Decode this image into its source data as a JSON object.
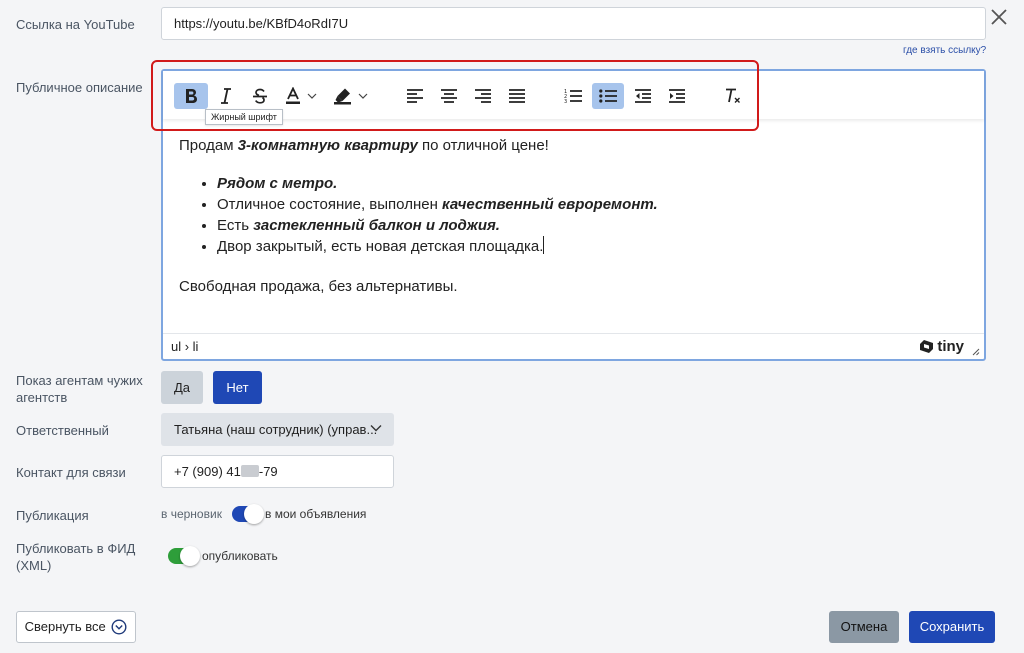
{
  "youtube": {
    "label": "Ссылка на YouTube",
    "value": "https://youtu.be/KBfD4oRdI7U",
    "help_link": "где взять ссылку?"
  },
  "description": {
    "label": "Публичное описание",
    "toolbar": {
      "tooltip": "Жирный шрифт",
      "buttons": [
        "bold",
        "italic",
        "strikethrough",
        "text-color",
        "highlight-color",
        "align-left",
        "align-center",
        "align-right",
        "align-justify",
        "numbered-list",
        "bullet-list",
        "outdent",
        "indent",
        "clear-formatting"
      ],
      "active": [
        "bold",
        "bullet-list"
      ]
    },
    "content": {
      "p1_before": "Продам ",
      "p1_bold": "3-комнатную квартиру",
      "p1_after": " по отличной цене!",
      "li1_bold": "Рядом с метро.",
      "li2_before": "Отличное состояние, выполнен ",
      "li2_bold": "качественный евроремонт.",
      "li3_before": "Есть ",
      "li3_bold": "застекленный балкон и лоджия.",
      "li4": "Двор закрытый, есть новая детская площадка.",
      "p2": "Свободная продажа, без альтернативы."
    },
    "status_path": "ul › li",
    "brand": "tiny"
  },
  "agents": {
    "label": "Показ агентам чужих агентств",
    "yes": "Да",
    "no": "Нет",
    "selected": "no"
  },
  "responsible": {
    "label": "Ответственный",
    "value": "Татьяна (наш сотрудник) (управ..."
  },
  "contact": {
    "label": "Контакт для связи",
    "value_start": "+7 (909) 41",
    "value_end": "-79"
  },
  "publication": {
    "label": "Публикация",
    "left": "в черновик",
    "right": "в мои объявления",
    "state": "в мои объявления"
  },
  "feed": {
    "label": "Публиковать в ФИД (XML)",
    "text": "опубликовать",
    "state": "on"
  },
  "footer": {
    "collapse": "Свернуть все",
    "cancel": "Отмена",
    "save": "Сохранить"
  },
  "colors": {
    "primary": "#1f48b5",
    "toggle_on": "#2e9e3a",
    "highlight_frame": "#d11a1a",
    "editor_active_button": "#a7c4ec"
  }
}
